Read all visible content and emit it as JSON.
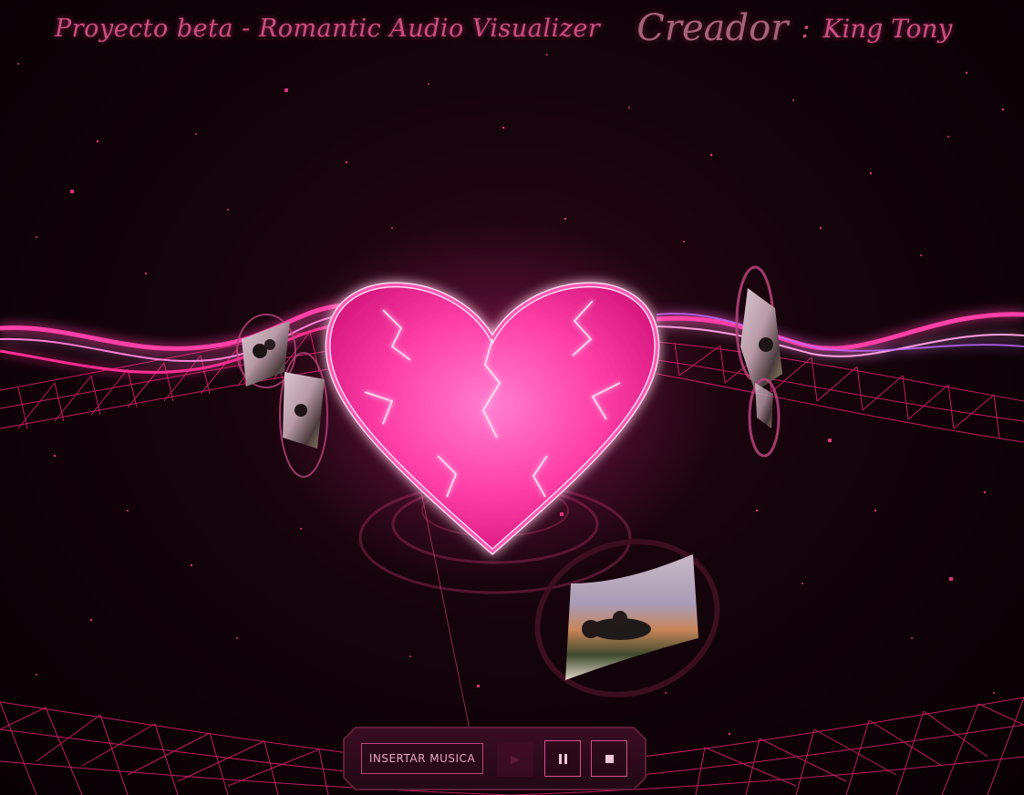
{
  "header": {
    "title": "Proyecto beta - Romantic Audio Visualizer",
    "creator_label": "Creador",
    "creator_separator": ":",
    "creator_name": "King Tony",
    "left_icon": "heart-outline-icon",
    "right_icon": "heart-outline-icon"
  },
  "visualizer": {
    "center_icon": "glowing-heart",
    "photo_cards": [
      "photo-card",
      "photo-card",
      "photo-card",
      "photo-card",
      "photo-card"
    ]
  },
  "controls": {
    "insert_label": "INSERTAR MUSICA",
    "play_icon": "play-icon",
    "pause_icon": "pause-icon",
    "stop_icon": "stop-icon"
  },
  "colors": {
    "accent": "#ff2f92",
    "heart_fill": "#ff49b0",
    "title_color": "#c94f7f",
    "background": "#0a0105"
  }
}
